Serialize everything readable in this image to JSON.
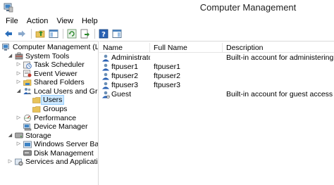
{
  "window": {
    "title": "Computer Management"
  },
  "menu": [
    "File",
    "Action",
    "View",
    "Help"
  ],
  "toolbar": {
    "buttons": [
      "back-arrow-icon",
      "forward-arrow-icon",
      "folder-up-icon",
      "show-hide-tree-icon",
      "refresh-icon",
      "export-list-icon",
      "help-icon",
      "properties-pane-icon"
    ]
  },
  "tree": [
    {
      "label": "Computer Management (Local",
      "level": 0,
      "expander": "",
      "icon": "computer-icon"
    },
    {
      "label": "System Tools",
      "level": 1,
      "expander": "expanded",
      "icon": "tools-icon"
    },
    {
      "label": "Task Scheduler",
      "level": 2,
      "expander": "collapsed",
      "icon": "clock-icon"
    },
    {
      "label": "Event Viewer",
      "level": 2,
      "expander": "collapsed",
      "icon": "event-viewer-icon"
    },
    {
      "label": "Shared Folders",
      "level": 2,
      "expander": "collapsed",
      "icon": "shared-folder-icon"
    },
    {
      "label": "Local Users and Groups",
      "level": 2,
      "expander": "expanded",
      "icon": "users-group-icon"
    },
    {
      "label": "Users",
      "level": 3,
      "expander": "",
      "icon": "folder-icon",
      "selected": true
    },
    {
      "label": "Groups",
      "level": 3,
      "expander": "",
      "icon": "folder-icon"
    },
    {
      "label": "Performance",
      "level": 2,
      "expander": "collapsed",
      "icon": "performance-icon"
    },
    {
      "label": "Device Manager",
      "level": 2,
      "expander": "",
      "icon": "device-manager-icon"
    },
    {
      "label": "Storage",
      "level": 1,
      "expander": "expanded",
      "icon": "storage-icon"
    },
    {
      "label": "Windows Server Backup",
      "level": 2,
      "expander": "collapsed",
      "icon": "backup-icon"
    },
    {
      "label": "Disk Management",
      "level": 2,
      "expander": "",
      "icon": "disk-icon"
    },
    {
      "label": "Services and Applications",
      "level": 1,
      "expander": "collapsed",
      "icon": "services-icon"
    }
  ],
  "list": {
    "columns": [
      "Name",
      "Full Name",
      "Description"
    ],
    "rows": [
      {
        "name": "Administrator",
        "full_name": "",
        "description": "Built-in account for administering..."
      },
      {
        "name": "ftpuser1",
        "full_name": "ftpuser1",
        "description": ""
      },
      {
        "name": "ftpuser2",
        "full_name": "ftpuser2",
        "description": ""
      },
      {
        "name": "ftpuser3",
        "full_name": "ftpuser3",
        "description": ""
      },
      {
        "name": "Guest",
        "full_name": "",
        "description": "Built-in account for guest access t..."
      }
    ]
  },
  "colors": {
    "selection": "#cce8ff",
    "selection_border": "#99d1ff",
    "folder": "#e8c35a"
  }
}
